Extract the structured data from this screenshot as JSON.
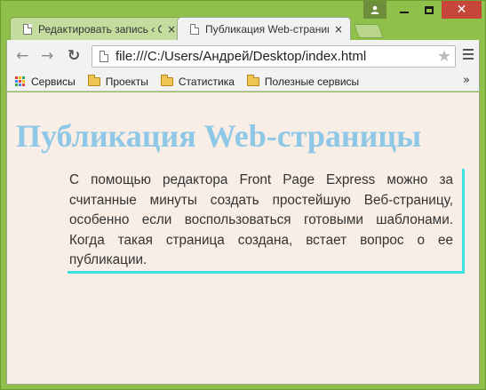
{
  "window": {
    "colors": {
      "frame": "#8fc04a",
      "close_button": "#c7463a",
      "page_background": "#f8eee6",
      "heading": "#8fc8e6",
      "quote_border": "#3ee0e0"
    }
  },
  "tabs": [
    {
      "title": "Редактировать запись ‹ С",
      "close_icon": "×",
      "active": false
    },
    {
      "title": "Публикация Web-страниц",
      "close_icon": "×",
      "active": true
    }
  ],
  "toolbar": {
    "back_icon": "←",
    "forward_icon": "→",
    "reload_icon": "↻",
    "url": "file:///C:/Users/Андрей/Desktop/index.html",
    "star_icon": "★"
  },
  "bookmarks": {
    "items": [
      {
        "label": "Сервисы",
        "icon": "apps-grid-icon"
      },
      {
        "label": "Проекты",
        "icon": "folder-icon"
      },
      {
        "label": "Статистика",
        "icon": "folder-icon"
      },
      {
        "label": "Полезные сервисы",
        "icon": "folder-icon"
      }
    ],
    "more_icon": "»"
  },
  "page": {
    "heading": "Публикация Web-страницы",
    "paragraph": "С помощью редактора Front Page Express можно за считанные минуты создать простейшую Веб-страницу, особенно если воспользоваться готовыми шаблонами. Когда такая страница создана, встает вопрос о ее публикации."
  }
}
